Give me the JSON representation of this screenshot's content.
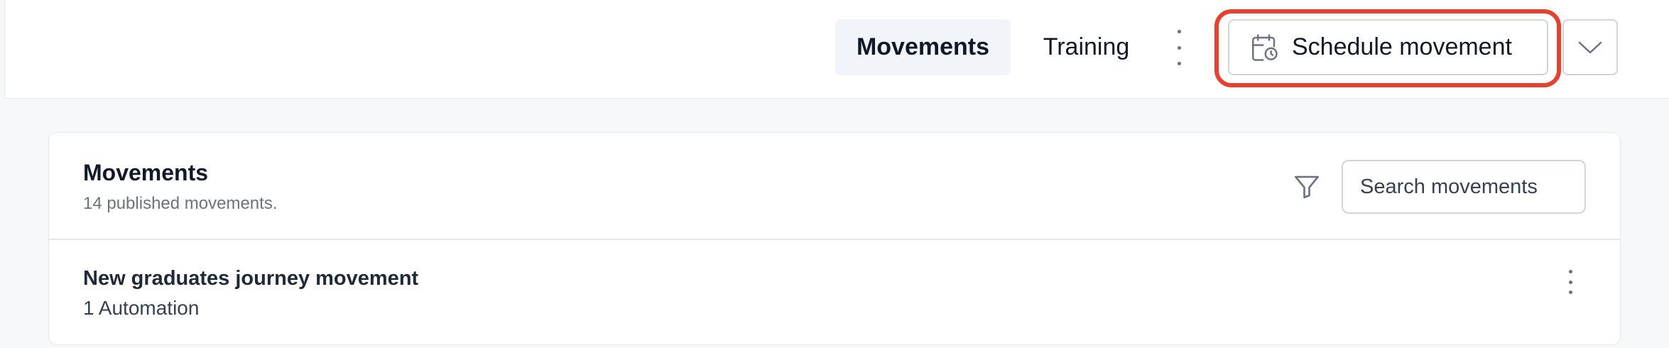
{
  "header": {
    "tabs": [
      {
        "label": "Movements",
        "active": true
      },
      {
        "label": "Training",
        "active": false
      }
    ],
    "more_icon": "vertical-ellipsis-icon",
    "schedule_button": {
      "label": "Schedule movement",
      "icon": "calendar-clock-icon"
    },
    "dropdown_icon": "chevron-down-icon",
    "highlight_color": "#e5412e"
  },
  "movements_card": {
    "title": "Movements",
    "subtitle": "14 published movements.",
    "filter_icon": "filter-icon",
    "search": {
      "placeholder": "Search movements",
      "value": ""
    },
    "items": [
      {
        "title": "New graduates journey movement",
        "subtitle": "1 Automation"
      }
    ]
  }
}
